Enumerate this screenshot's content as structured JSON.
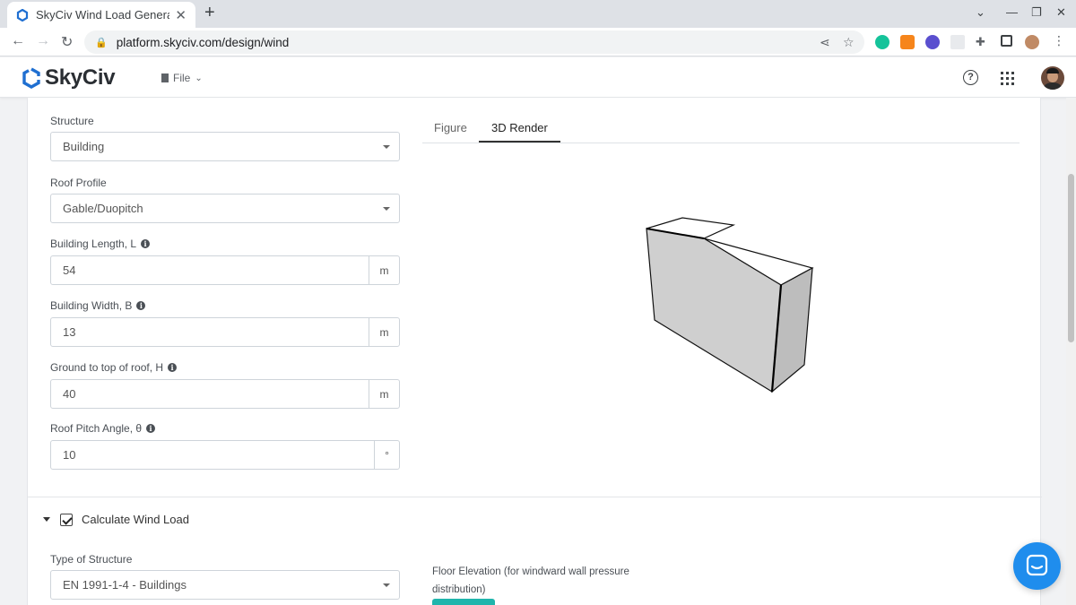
{
  "browser": {
    "tab_title": "SkyCiv Wind Load General",
    "url": "platform.skyciv.com/design/wind"
  },
  "app": {
    "logo_text": "SkyCiv",
    "file_menu": "File",
    "help_glyph": "?"
  },
  "form": {
    "structure": {
      "label": "Structure",
      "value": "Building"
    },
    "roof_profile": {
      "label": "Roof Profile",
      "value": "Gable/Duopitch"
    },
    "building_length": {
      "label": "Building Length, L",
      "value": "54",
      "unit": "m"
    },
    "building_width": {
      "label": "Building Width, B",
      "value": "13",
      "unit": "m"
    },
    "height": {
      "label": "Ground to top of roof, H",
      "value": "40",
      "unit": "m"
    },
    "roof_pitch": {
      "label": "Roof Pitch Angle, θ",
      "value": "10",
      "unit": "°"
    }
  },
  "preview": {
    "tabs": [
      {
        "label": "Figure"
      },
      {
        "label": "3D Render"
      }
    ],
    "active_tab": "3D Render"
  },
  "wind": {
    "section_title": "Calculate Wind Load",
    "checked": true,
    "type_of_structure": {
      "label": "Type of Structure",
      "value": "EN 1991-1-4 - Buildings"
    },
    "floor_elevation_label": "Floor Elevation (for windward wall pressure distribution)"
  },
  "colors": {
    "accent": "#1fb5ac",
    "brand_blue": "#1f8ded"
  }
}
